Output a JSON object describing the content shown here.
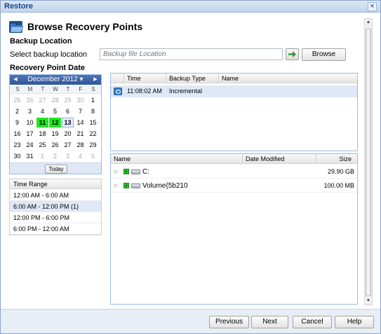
{
  "window": {
    "title": "Restore"
  },
  "header": {
    "title": "Browse Recovery Points",
    "icon": "folder-open-icon"
  },
  "backup_location": {
    "section_title": "Backup Location",
    "label": "Select backup location",
    "placeholder": "Backup file Location",
    "browse_label": "Browse"
  },
  "recovery_point_date": {
    "section_title": "Recovery Point Date",
    "calendar": {
      "month_label": "December 2012",
      "weekdays": [
        "S",
        "M",
        "T",
        "W",
        "T",
        "F",
        "S"
      ],
      "weeks": [
        [
          "25",
          "26",
          "27",
          "28",
          "29",
          "30",
          "1"
        ],
        [
          "2",
          "3",
          "4",
          "5",
          "6",
          "7",
          "8"
        ],
        [
          "9",
          "10",
          "11",
          "12",
          "13",
          "14",
          "15"
        ],
        [
          "16",
          "17",
          "18",
          "19",
          "20",
          "21",
          "22"
        ],
        [
          "23",
          "24",
          "25",
          "26",
          "27",
          "28",
          "29"
        ],
        [
          "30",
          "31",
          "1",
          "2",
          "3",
          "4",
          "5"
        ]
      ],
      "backup_days": [
        "11",
        "12"
      ],
      "selected_day": "13",
      "today_label": "Today"
    }
  },
  "time_range": {
    "header": "Time Range",
    "items": [
      "12:00 AM - 6:00 AM",
      "6:00 AM - 12:00 PM (1)",
      "12:00 PM - 6:00 PM",
      "6:00 PM - 12:00 AM"
    ],
    "selected_index": 1
  },
  "recovery_points": {
    "columns": [
      "Time",
      "Backup Type",
      "Name"
    ],
    "rows": [
      {
        "time": "11:08:02 AM",
        "backup_type": "Incremental",
        "name": ""
      }
    ]
  },
  "volumes": {
    "columns": [
      "Name",
      "Date Modified",
      "Size"
    ],
    "rows": [
      {
        "name": "C:",
        "date_modified": "",
        "size": "29.90 GB"
      },
      {
        "name": "Volume{5b210",
        "date_modified": "",
        "size": "100.00 MB"
      }
    ]
  },
  "footer": {
    "previous_label": "Previous",
    "next_label": "Next",
    "cancel_label": "Cancel",
    "help_label": "Help"
  },
  "colors": {
    "backup_day": "#1ee81e",
    "header_blue": "#15428b",
    "selection": "#dfe8f6"
  }
}
